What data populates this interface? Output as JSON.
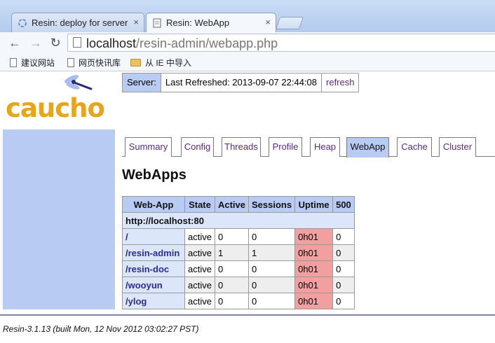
{
  "browser": {
    "tabs": [
      {
        "title": "Resin: deploy for server",
        "active": false
      },
      {
        "title": "Resin: WebApp",
        "active": true
      }
    ],
    "url": {
      "host": "localhost",
      "path": "/resin-admin/webapp.php"
    },
    "bookmarks": [
      {
        "label": "建议网站",
        "icon": "page-icon"
      },
      {
        "label": "网页快讯库",
        "icon": "page-icon"
      },
      {
        "label": "从 IE 中导入",
        "icon": "folder-icon"
      }
    ]
  },
  "logo": {
    "text": "caucho",
    "brand_color": "#e8a41a"
  },
  "server_bar": {
    "server_label": "Server:",
    "last_refreshed": "Last Refreshed: 2013-09-07 22:44:08",
    "refresh_label": "refresh"
  },
  "page_tabs": [
    "Summary",
    "Config",
    "Threads",
    "Profile",
    "Heap",
    "WebApp",
    "Cache",
    "Cluster"
  ],
  "selected_tab": "WebApp",
  "heading": "WebApps",
  "table": {
    "columns": [
      "Web-App",
      "State",
      "Active",
      "Sessions",
      "Uptime",
      "500"
    ],
    "host": "http://localhost:80",
    "rows": [
      {
        "name": "/",
        "state": "active",
        "active": "0",
        "sessions": "0",
        "uptime": "0h01",
        "errors": "0"
      },
      {
        "name": "/resin-admin",
        "state": "active",
        "active": "1",
        "sessions": "1",
        "uptime": "0h01",
        "errors": "0"
      },
      {
        "name": "/resin-doc",
        "state": "active",
        "active": "0",
        "sessions": "0",
        "uptime": "0h01",
        "errors": "0"
      },
      {
        "name": "/wooyun",
        "state": "active",
        "active": "0",
        "sessions": "0",
        "uptime": "0h01",
        "errors": "0"
      },
      {
        "name": "/ylog",
        "state": "active",
        "active": "0",
        "sessions": "0",
        "uptime": "0h01",
        "errors": "0"
      }
    ]
  },
  "footer": "Resin-3.1.13 (built Mon, 12 Nov 2012 03:02:27 PST)",
  "colors": {
    "accent": "#b8cbf3",
    "uptime_warning": "#f49f9f",
    "link": "#5a2a8a"
  }
}
